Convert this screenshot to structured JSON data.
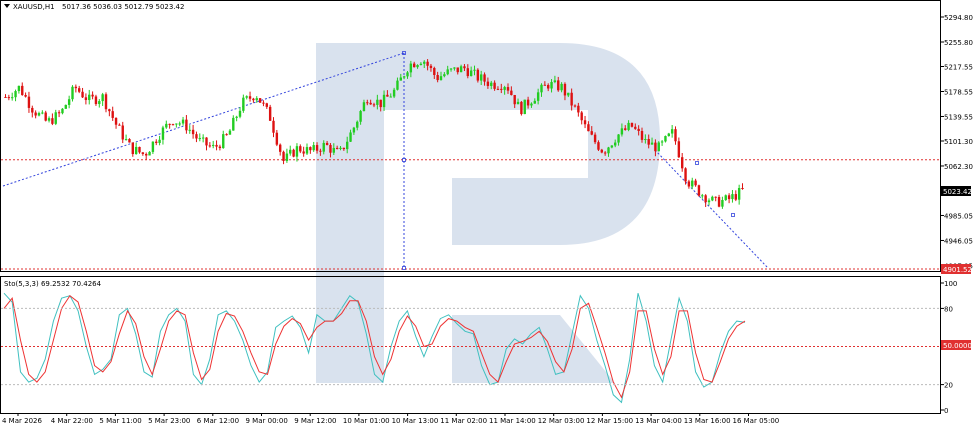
{
  "header": {
    "symbol": "XAUUSD,H1",
    "ohlc": "5017.36 5036.03 5012.79 5023.42"
  },
  "price_panel": {
    "y_ticks": [
      "5294.80",
      "5255.80",
      "5217.55",
      "5178.55",
      "5139.55",
      "5101.30",
      "5062.30",
      "5023.42",
      "4985.05",
      "4946.05",
      "4907.05"
    ],
    "current_price_label": "5023.42",
    "low_marker_label": "4901.52",
    "ref_price": 5072,
    "low_price": 4901.52
  },
  "stoch_panel": {
    "label": "Sto(5,3,3) 69.2532 70.4264",
    "y_ticks": [
      "100",
      "80",
      "50.0000",
      "20",
      "0"
    ],
    "levels": [
      80,
      50,
      20
    ]
  },
  "x_axis": {
    "ticks": [
      "4 Mar 2026",
      "4 Mar 22:00",
      "5 Mar 11:00",
      "5 Mar 23:00",
      "6 Mar 12:00",
      "9 Mar 00:00",
      "9 Mar 12:00",
      "10 Mar 01:00",
      "10 Mar 13:00",
      "11 Mar 02:00",
      "11 Mar 14:00",
      "12 Mar 03:00",
      "12 Mar 15:00",
      "13 Mar 04:00",
      "13 Mar 16:00",
      "16 Mar 05:00"
    ]
  },
  "colors": {
    "bull": "#22cc22",
    "bear": "#dd1111",
    "level": "#e03030",
    "trend": "#3344dd",
    "stoch_main": "#40c0c0",
    "stoch_signal": "#ee3333",
    "watermark": "#d5dfec"
  },
  "chart_data": {
    "type": "candlestick",
    "instrument": "XAUUSD",
    "timeframe": "H1",
    "close_path": [
      5170,
      5185,
      5150,
      5130,
      5145,
      5185,
      5165,
      5170,
      5125,
      5090,
      5080,
      5110,
      5135,
      5125,
      5100,
      5090,
      5110,
      5160,
      5175,
      5140,
      5070,
      5090,
      5085,
      5095,
      5080,
      5120,
      5170,
      5160,
      5180,
      5220,
      5230,
      5200,
      5210,
      5215,
      5200,
      5190,
      5190,
      5150,
      5170,
      5190,
      5185,
      5150,
      5110,
      5085,
      5110,
      5125,
      5100,
      5090,
      5115,
      5040,
      5020,
      5005,
      5010,
      5023.42
    ],
    "current_close": 5023.42,
    "stoch_main": [
      92,
      85,
      30,
      22,
      25,
      40,
      70,
      88,
      90,
      78,
      50,
      28,
      32,
      40,
      75,
      80,
      60,
      30,
      26,
      62,
      75,
      80,
      70,
      28,
      20,
      40,
      75,
      78,
      70,
      55,
      35,
      22,
      30,
      65,
      70,
      74,
      65,
      45,
      75,
      70,
      70,
      80,
      90,
      85,
      60,
      28,
      22,
      50,
      70,
      78,
      58,
      42,
      58,
      72,
      75,
      68,
      62,
      60,
      35,
      20,
      22,
      48,
      56,
      52,
      60,
      65,
      48,
      28,
      30,
      60,
      90,
      80,
      55,
      35,
      12,
      6,
      40,
      92,
      70,
      35,
      22,
      55,
      88,
      70,
      30,
      18,
      22,
      45,
      62,
      70,
      69
    ],
    "stoch_signal": [
      80,
      88,
      55,
      28,
      22,
      30,
      55,
      80,
      90,
      85,
      62,
      35,
      30,
      38,
      60,
      78,
      68,
      42,
      28,
      48,
      70,
      78,
      75,
      45,
      24,
      32,
      62,
      76,
      74,
      62,
      45,
      30,
      28,
      52,
      66,
      72,
      68,
      55,
      65,
      70,
      70,
      76,
      86,
      86,
      70,
      42,
      28,
      40,
      62,
      74,
      66,
      50,
      52,
      66,
      72,
      70,
      65,
      62,
      45,
      28,
      22,
      38,
      52,
      54,
      57,
      62,
      54,
      38,
      30,
      48,
      80,
      84,
      65,
      45,
      22,
      10,
      30,
      78,
      78,
      48,
      28,
      42,
      78,
      78,
      45,
      24,
      22,
      38,
      56,
      66,
      70
    ]
  }
}
